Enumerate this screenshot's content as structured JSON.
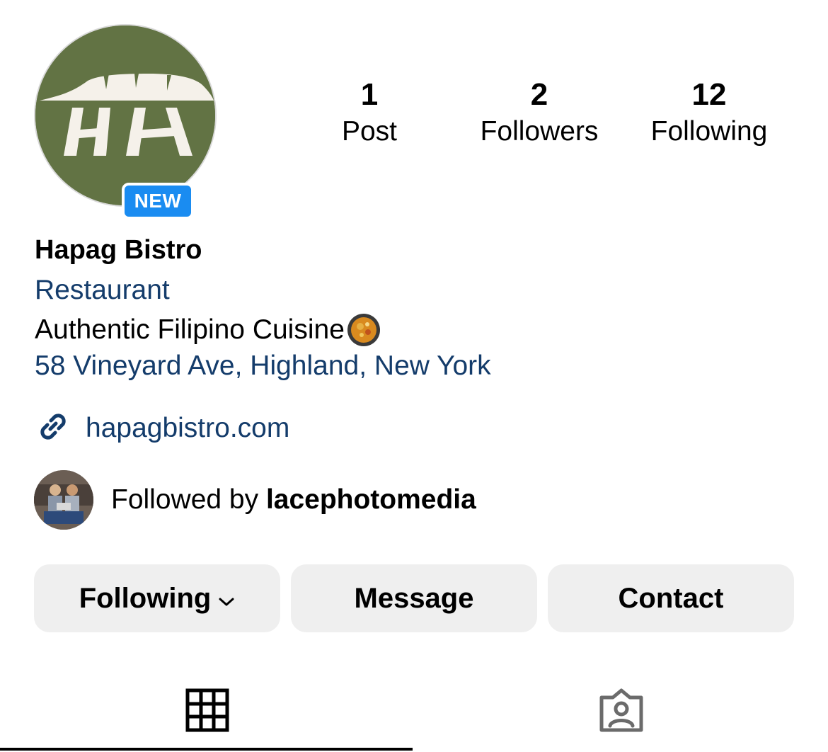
{
  "profile": {
    "avatar_badge": "NEW",
    "name": "Hapag Bistro",
    "category": "Restaurant",
    "description": "Authentic Filipino Cuisine",
    "description_emoji": "paella-pan-icon",
    "address": "58 Vineyard Ave, Highland, New York",
    "website": "hapagbistro.com",
    "brand_color": "#627344"
  },
  "stats": {
    "posts": {
      "value": "1",
      "label": "Post"
    },
    "followers": {
      "value": "2",
      "label": "Followers"
    },
    "following": {
      "value": "12",
      "label": "Following"
    }
  },
  "followed_by": {
    "prefix": "Followed by ",
    "user": "lacephotomedia"
  },
  "buttons": {
    "following": "Following",
    "message": "Message",
    "contact": "Contact"
  },
  "tabs": [
    {
      "icon": "grid-icon",
      "active": true
    },
    {
      "icon": "tagged-person-icon",
      "active": false
    }
  ],
  "colors": {
    "link": "#143c6b",
    "badge": "#1a8cf1",
    "button_bg": "#efefef"
  }
}
